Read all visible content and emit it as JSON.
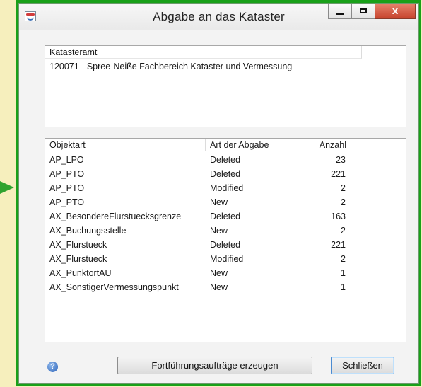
{
  "window": {
    "title": "Abgabe an das Kataster",
    "controls": {
      "minimize": "–",
      "maximize": "□",
      "close": "x"
    }
  },
  "kataster": {
    "header": "Katasteramt",
    "value": "120071 - Spree-Neiße Fachbereich Kataster und Vermessung"
  },
  "table": {
    "columns": [
      "Objektart",
      "Art der Abgabe",
      "Anzahl"
    ],
    "rows": [
      [
        "AP_LPO",
        "Deleted",
        "23"
      ],
      [
        "AP_PTO",
        "Deleted",
        "221"
      ],
      [
        "AP_PTO",
        "Modified",
        "2"
      ],
      [
        "AP_PTO",
        "New",
        "2"
      ],
      [
        "AX_BesondereFlurstuecksgrenze",
        "Deleted",
        "163"
      ],
      [
        "AX_Buchungsstelle",
        "New",
        "2"
      ],
      [
        "AX_Flurstueck",
        "Deleted",
        "221"
      ],
      [
        "AX_Flurstueck",
        "Modified",
        "2"
      ],
      [
        "AX_PunktortAU",
        "New",
        "1"
      ],
      [
        "AX_SonstigerVermessungspunkt",
        "New",
        "1"
      ]
    ]
  },
  "footer": {
    "help_icon": "question-mark-icon",
    "create_button": "Fortführungsaufträge erzeugen",
    "close_button": "Schließen"
  },
  "colors": {
    "frame": "#19a019",
    "background": "#f6efbd",
    "close_button": "#c7442d"
  }
}
